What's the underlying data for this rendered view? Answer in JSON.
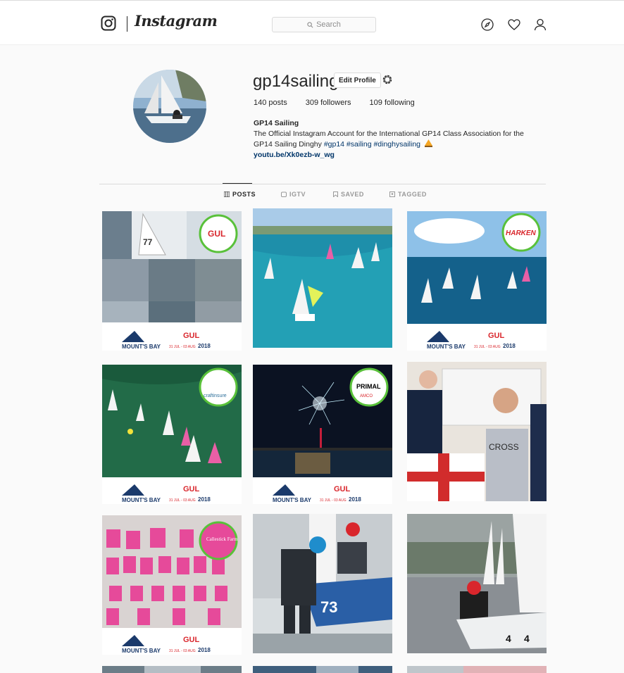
{
  "header": {
    "brand": "Instagram",
    "search_placeholder": "Search"
  },
  "profile": {
    "username": "gp14sailing",
    "edit_button": "Edit Profile",
    "stats": {
      "posts": "140 posts",
      "followers": "309 followers",
      "following": "109 following"
    },
    "bio": {
      "name": "GP14 Sailing",
      "line1": "The Official Instagram Account for the International GP14 Class Association for the",
      "line2_prefix": "GP14 Sailing Dinghy ",
      "tags": "#gp14 #sailing #dinghysailing",
      "link": "youtu.be/Xk0ezb-w_wg"
    }
  },
  "tabs": [
    {
      "label": "POSTS"
    },
    {
      "label": "IGTV"
    },
    {
      "label": "SAVED"
    },
    {
      "label": "TAGGED"
    }
  ],
  "overlay_text": {
    "gul": "GUL",
    "mounts_bay": "MOUNT'S BAY",
    "year": "2018",
    "dates": "31 JUL - 03 AUG",
    "harken": "HARKEN",
    "primal": "PRIMAL",
    "craft": "craftinsure",
    "amco": "AMCO",
    "cross": "CROSS",
    "callestick": "Callestick Farm",
    "sail_number": "77",
    "hull_number": "73"
  },
  "colors": {
    "accent": "#262626",
    "link": "#003569",
    "border": "#dbdbdb"
  }
}
